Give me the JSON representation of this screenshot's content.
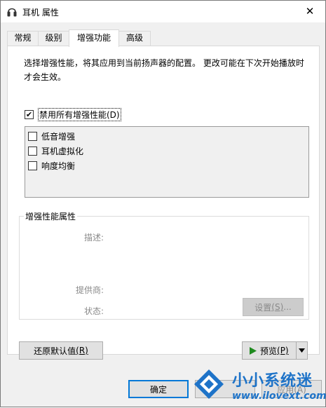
{
  "window": {
    "title": "耳机 属性",
    "close_glyph": "✕"
  },
  "tabs": [
    {
      "label": "常规"
    },
    {
      "label": "级别"
    },
    {
      "label": "增强功能",
      "active": true
    },
    {
      "label": "高级"
    }
  ],
  "panel": {
    "description": "选择增强性能，将其应用到当前扬声器的配置。 更改可能在下次开始播放时才会生效。",
    "disable_all": {
      "label": "禁用所有增强性能(D)",
      "checked": true
    },
    "enhancements": [
      {
        "label": "低音增强",
        "checked": false
      },
      {
        "label": "耳机虚拟化",
        "checked": false
      },
      {
        "label": "响度均衡",
        "checked": false
      }
    ],
    "properties": {
      "title": "增强性能属性",
      "description_label": "描述:",
      "provider_label": "提供商:",
      "status_label": "状态:",
      "settings_button": {
        "label": "设置",
        "mnemonic": "(S)",
        "suffix": "..."
      }
    }
  },
  "buttons": {
    "restore_defaults": {
      "label": "还原默认值",
      "mnemonic": "(R)"
    },
    "preview": {
      "label": "预览",
      "mnemonic": "(P)"
    },
    "ok": {
      "label": "确定"
    },
    "apply": {
      "label": "应用(A)"
    }
  },
  "watermark": {
    "name": "小小系统迷",
    "url": "www.ilovext.com"
  },
  "colors": {
    "watermark_blue": "#1e73c8",
    "dialog_bg": "#f0f0f0"
  }
}
